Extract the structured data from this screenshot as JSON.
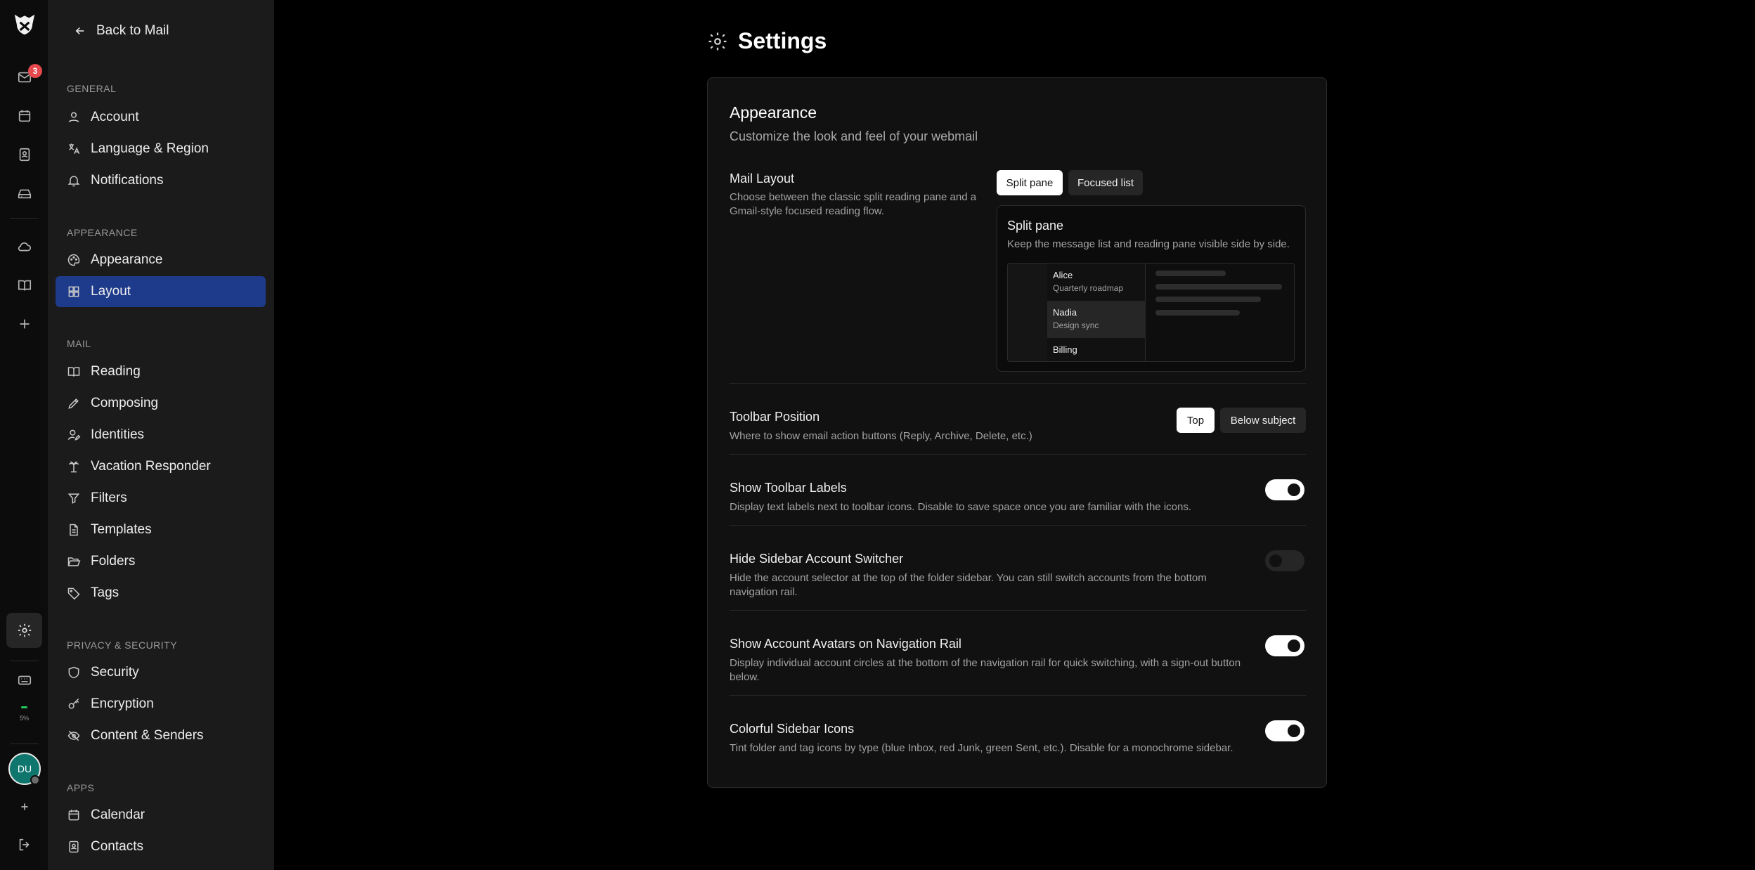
{
  "rail": {
    "mail_badge": "3",
    "storage": "5%",
    "avatar_initials": "DU",
    "icons": [
      "logo-icon",
      "mail-icon",
      "calendar-icon",
      "contacts-icon",
      "drive-icon",
      "cloud-icon",
      "book-icon",
      "plus-icon",
      "gear-icon",
      "keyboard-icon",
      "add-account-icon",
      "logout-icon"
    ]
  },
  "sidebar": {
    "back_label": "Back to Mail",
    "sections": [
      {
        "title": "GENERAL",
        "items": [
          "Account",
          "Language & Region",
          "Notifications"
        ]
      },
      {
        "title": "APPEARANCE",
        "items": [
          "Appearance",
          "Layout"
        ]
      },
      {
        "title": "MAIL",
        "items": [
          "Reading",
          "Composing",
          "Identities",
          "Vacation Responder",
          "Filters",
          "Templates",
          "Folders",
          "Tags"
        ]
      },
      {
        "title": "PRIVACY & SECURITY",
        "items": [
          "Security",
          "Encryption",
          "Content & Senders"
        ]
      },
      {
        "title": "APPS",
        "items": [
          "Calendar",
          "Contacts"
        ]
      }
    ],
    "active_item": "Layout"
  },
  "main": {
    "title": "Settings",
    "card_title": "Appearance",
    "card_subtitle": "Customize the look and feel of your webmail",
    "mail_layout": {
      "title": "Mail Layout",
      "description": "Choose between the classic split reading pane and a Gmail-style focused reading flow.",
      "options": [
        "Split pane",
        "Focused list"
      ],
      "selected": "Split pane",
      "preview": {
        "title": "Split pane",
        "description": "Keep the message list and reading pane visible side by side.",
        "messages": [
          {
            "name": "Alice",
            "subject": "Quarterly roadmap"
          },
          {
            "name": "Nadia",
            "subject": "Design sync"
          },
          {
            "name": "Billing",
            "subject": ""
          }
        ]
      }
    },
    "toolbar_position": {
      "title": "Toolbar Position",
      "description": "Where to show email action buttons (Reply, Archive, Delete, etc.)",
      "options": [
        "Top",
        "Below subject"
      ],
      "selected": "Top"
    },
    "toggles": [
      {
        "title": "Show Toolbar Labels",
        "description": "Display text labels next to toolbar icons. Disable to save space once you are familiar with the icons.",
        "on": true
      },
      {
        "title": "Hide Sidebar Account Switcher",
        "description": "Hide the account selector at the top of the folder sidebar. You can still switch accounts from the bottom navigation rail.",
        "on": false
      },
      {
        "title": "Show Account Avatars on Navigation Rail",
        "description": "Display individual account circles at the bottom of the navigation rail for quick switching, with a sign-out button below.",
        "on": true
      },
      {
        "title": "Colorful Sidebar Icons",
        "description": "Tint folder and tag icons by type (blue Inbox, red Junk, green Sent, etc.). Disable for a monochrome sidebar.",
        "on": true
      }
    ]
  },
  "colors": {
    "active_nav": "#1e3a8a",
    "badge": "#e5484d",
    "avatar": "#0f766e",
    "storage": "#22c55e"
  }
}
